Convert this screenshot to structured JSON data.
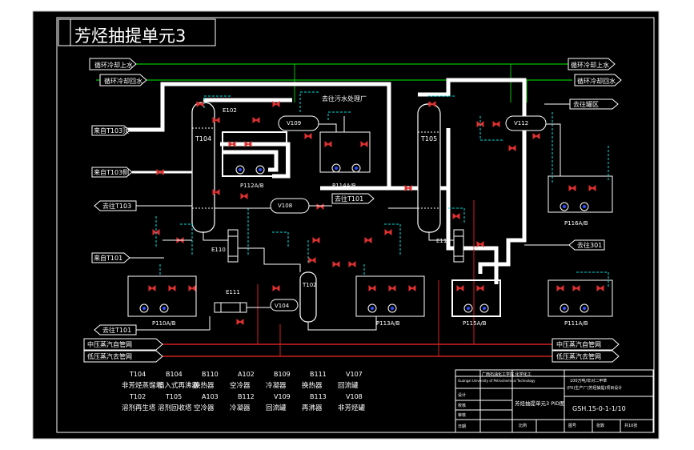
{
  "title": "芳烃抽提单元3",
  "left_lines": {
    "top1": "循环冷却上水",
    "top2": "循环冷却回水",
    "feed1": "来自T103顶",
    "feed2": "来自T103侧",
    "to_t103": "去往T103",
    "from_t101": "来自T101",
    "to_t101": "去往T101",
    "bottom1": "中压蒸汽自管网",
    "bottom2": "低压蒸汽去管网"
  },
  "right_lines": {
    "top1": "循环冷却上水",
    "top2": "循环冷却回水",
    "to_storage": "去往罐区",
    "to_301": "去往301",
    "bottom1": "中压蒸汽自管网",
    "bottom2": "低压蒸汽去管网"
  },
  "mid_labels": {
    "waste": "去往污水处理厂",
    "to_t101_mid": "去往T101"
  },
  "equipment_tags": {
    "t104": "T104",
    "t105": "T105",
    "t102": "T102",
    "v109": "V109",
    "v112": "V112",
    "v108": "V108",
    "v104": "V104",
    "e102": "E102",
    "e110": "E110",
    "e111": "E111",
    "e113": "E113",
    "p112": "P112A/B",
    "p114": "P114A/B",
    "p113": "P113A/B",
    "p110": "P110A/B",
    "p115": "P115A/B",
    "p116": "P116A/B",
    "p111": "P111A/B"
  },
  "legend": [
    {
      "code": "T104",
      "name": "非芳烃蒸馏塔"
    },
    {
      "code": "B104",
      "name": "插入式再沸器"
    },
    {
      "code": "B110",
      "name": "换热器"
    },
    {
      "code": "A102",
      "name": "空冷器"
    },
    {
      "code": "B109",
      "name": "冷凝器"
    },
    {
      "code": "B111",
      "name": "换热器"
    },
    {
      "code": "V107",
      "name": "回流罐"
    },
    {
      "code": "T102",
      "name": "溶剂再生塔"
    },
    {
      "code": "T105",
      "name": "溶剂回收塔"
    },
    {
      "code": "A103",
      "name": "空冷器"
    },
    {
      "code": "B112",
      "name": "冷凝器"
    },
    {
      "code": "V109",
      "name": "回流罐"
    },
    {
      "code": "B113",
      "name": "再沸器"
    },
    {
      "code": "V108",
      "name": "非芳烃罐"
    }
  ],
  "title_block": {
    "school": "广西石油化工学院  化学化工",
    "school_en": "Guangxi University of Petrochemical Technology",
    "project1": "100万吨/年对二甲苯",
    "project2": "(PX)生产厂(芳烃抽提)项目设计",
    "drawing_name": "芳烃抽提单元3 PID图",
    "drawing_no": "GSH.15-0-1-1/10",
    "rows": [
      "设计",
      "制图",
      "校核",
      "审核",
      "审定",
      "日期"
    ],
    "bottom_cells": [
      "比例",
      "图号",
      "张数",
      "共10张"
    ]
  },
  "colors": {
    "background": "#000000",
    "line": "#ffffff",
    "steam": "#d42020",
    "water": "#00c000",
    "instrument": "#00e0e0",
    "pump": "#3050ff",
    "valve": "#e03030",
    "accent": "#d0d020"
  }
}
